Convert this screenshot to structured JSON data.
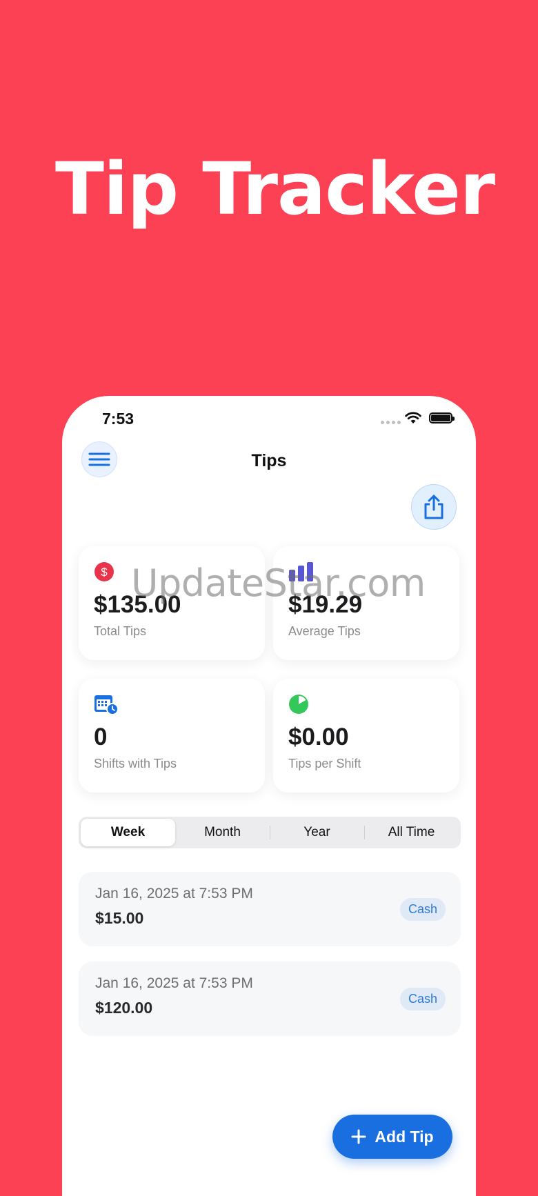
{
  "headline": "Tip Tracker",
  "status_bar": {
    "time": "7:53"
  },
  "nav": {
    "title": "Tips"
  },
  "watermark": "UpdateStar.com",
  "stats": [
    {
      "icon": "dollar-icon",
      "value": "$135.00",
      "label": "Total Tips",
      "color": "#e8344a"
    },
    {
      "icon": "bar-chart-icon",
      "value": "$19.29",
      "label": "Average Tips",
      "color": "#5856d6"
    },
    {
      "icon": "calendar-clock-icon",
      "value": "0",
      "label": "Shifts with Tips",
      "color": "#1a6fe0"
    },
    {
      "icon": "pie-chart-icon",
      "value": "$0.00",
      "label": "Tips per Shift",
      "color": "#34c759"
    }
  ],
  "period_tabs": {
    "selected": "Week",
    "items": [
      "Week",
      "Month",
      "Year",
      "All Time"
    ]
  },
  "tips": [
    {
      "date": "Jan 16, 2025 at 7:53 PM",
      "amount": "$15.00",
      "method": "Cash"
    },
    {
      "date": "Jan 16, 2025 at 7:53 PM",
      "amount": "$120.00",
      "method": "Cash"
    }
  ],
  "add_button": {
    "label": "Add Tip"
  },
  "colors": {
    "background": "#fd4155",
    "accent": "#1a6fe0"
  }
}
